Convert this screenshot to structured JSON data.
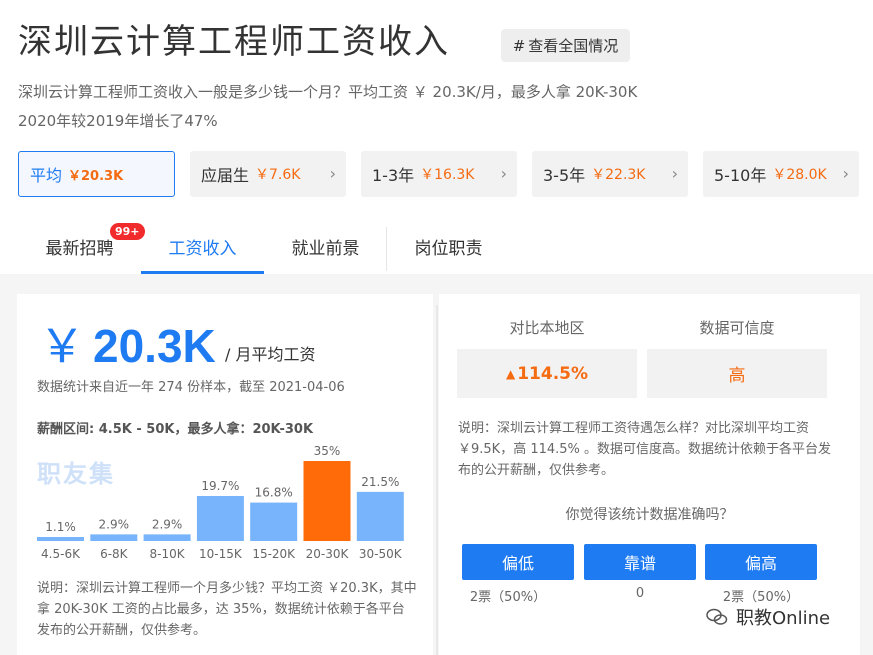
{
  "header": {
    "title": "深圳云计算工程师工资收入",
    "nation_button": "查看全国情况",
    "summary_line1": "深圳云计算工程师工资收入一般是多少钱一个月？平均工资 ￥ 20.3K/月，最多人拿 20K-30K",
    "summary_line2": "2020年较2019年增长了47%"
  },
  "stat_tabs": [
    {
      "label": "平均",
      "value": "￥20.3K"
    },
    {
      "label": "应届生",
      "value": "￥7.6K"
    },
    {
      "label": "1-3年",
      "value": "￥16.3K"
    },
    {
      "label": "3-5年",
      "value": "￥22.3K"
    },
    {
      "label": "5-10年",
      "value": "￥28.0K"
    }
  ],
  "nav": {
    "tabs": [
      "最新招聘",
      "工资收入",
      "就业前景",
      "岗位职责"
    ],
    "badge": "99+"
  },
  "left": {
    "yen": "￥",
    "amount": "20.3K",
    "unit": "/ 月平均工资",
    "sample_note": "数据统计来自近一年 274 份样本，截至 2021-04-06",
    "range_note": "薪酬区间: 4.5K - 50K，最多人拿：20K-30K",
    "logo_text": "职友集",
    "desc": "说明：深圳云计算工程师一个月多少钱？平均工资 ￥20.3K，其中拿 20K-30K 工资的占比最多，达 35%，数据统计依赖于各平台发布的公开薪酬，仅供参考。"
  },
  "chart_data": {
    "type": "bar",
    "categories": [
      "4.5-6K",
      "6-8K",
      "8-10K",
      "10-15K",
      "15-20K",
      "20-30K",
      "30-50K"
    ],
    "values": [
      1.1,
      2.9,
      2.9,
      19.7,
      16.8,
      35,
      21.5
    ],
    "labels": [
      "1.1%",
      "2.9%",
      "2.9%",
      "19.7%",
      "16.8%",
      "35%",
      "21.5%"
    ],
    "highlight_index": 5,
    "colors": {
      "normal": "#78b4fb",
      "highlight": "#fe6b08"
    },
    "ylim": [
      0,
      35
    ]
  },
  "right": {
    "compare_label": "对比本地区",
    "compare_value": "114.5%",
    "trust_label": "数据可信度",
    "trust_value": "高",
    "desc": "说明：深圳云计算工程师工资待遇怎么样？对比深圳平均工资 ￥9.5K，高 114.5% 。数据可信度高。数据统计依赖于各平台发布的公开薪酬，仅供参考。",
    "question": "你觉得该统计数据准确吗？",
    "votes": [
      {
        "label": "偏低",
        "count": "2票（50%）"
      },
      {
        "label": "靠谱",
        "count": "0"
      },
      {
        "label": "偏高",
        "count": "2票（50%）"
      }
    ]
  },
  "watermark": {
    "text": "职教Online"
  },
  "colors": {
    "accent": "#1f7bf2",
    "orange": "#f56b11"
  }
}
